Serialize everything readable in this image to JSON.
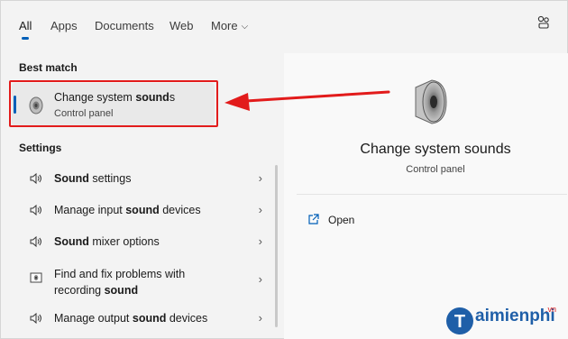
{
  "tabs": [
    {
      "label": "All"
    },
    {
      "label": "Apps"
    },
    {
      "label": "Documents"
    },
    {
      "label": "Web"
    },
    {
      "label": "More"
    }
  ],
  "sections": {
    "best_match_title": "Best match",
    "settings_title": "Settings"
  },
  "best_match": {
    "title_prefix": "Change system ",
    "title_bold": "sound",
    "title_suffix": "s",
    "subtitle": "Control panel",
    "icon": "speaker-icon"
  },
  "settings_items": [
    {
      "pre": "",
      "bold": "Sound",
      "post": " settings",
      "icon": "speaker-volume-icon"
    },
    {
      "pre": "Manage input ",
      "bold": "sound",
      "post": " devices",
      "icon": "speaker-volume-icon"
    },
    {
      "pre": "",
      "bold": "Sound",
      "post": " mixer options",
      "icon": "speaker-volume-icon"
    },
    {
      "pre": "Find and fix problems with recording ",
      "bold": "sound",
      "post": "",
      "icon": "troubleshoot-icon"
    },
    {
      "pre": "Manage output ",
      "bold": "sound",
      "post": " devices",
      "icon": "speaker-volume-icon"
    }
  ],
  "detail": {
    "title": "Change system sounds",
    "subtitle": "Control panel",
    "actions": [
      {
        "label": "Open",
        "icon": "open-external-icon"
      }
    ]
  },
  "watermark": {
    "text": "aimienphi",
    "suffix": ".vn"
  },
  "colors": {
    "accent": "#005fb8",
    "highlight_box": "#e21b1b",
    "annotation_arrow": "#e21b1b"
  }
}
